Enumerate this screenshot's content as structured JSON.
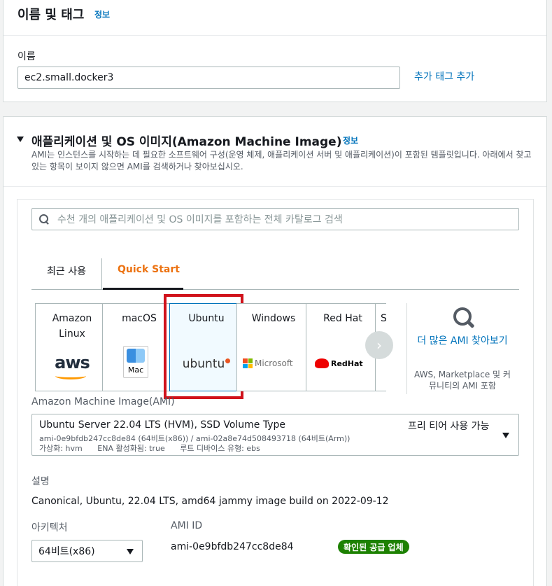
{
  "name_section": {
    "title": "이름 및 태그",
    "info": "정보",
    "name_label": "이름",
    "name_value": "ec2.small.docker3",
    "add_tag": "추가 태그 추가"
  },
  "ami_section": {
    "title": "애플리케이션 및 OS 이미지(Amazon Machine Image)",
    "info": "정보",
    "description": "AMI는 인스턴스를 시작하는 데 필요한 소프트웨어 구성(운영 체제, 애플리케이션 서버 및 애플리케이션)이 포함된 템플릿입니다. 아래에서 찾고 있는 항목이 보이지 않으면 AMI를 검색하거나 찾아보십시오.",
    "search_placeholder": "수천 개의 애플리케이션 및 OS 이미지를 포함하는 전체 카탈로그 검색",
    "tabs": [
      {
        "label": "최근 사용",
        "active": false
      },
      {
        "label": "Quick Start",
        "active": true
      }
    ],
    "os_cards": [
      {
        "name": "Amazon Linux",
        "logo": "aws"
      },
      {
        "name": "macOS",
        "logo": "Mac"
      },
      {
        "name": "Ubuntu",
        "logo": "ubuntu",
        "selected": true
      },
      {
        "name": "Windows",
        "logo": "Microsoft"
      },
      {
        "name": "Red Hat",
        "logo": "RedHat"
      },
      {
        "name": "S"
      }
    ],
    "more": {
      "link": "더 많은 AMI 찾아보기",
      "desc": "AWS, Marketplace 및 커뮤니티의 AMI 포함"
    },
    "ami_label": "Amazon Machine Image(AMI)",
    "ami_selected": {
      "name": "Ubuntu Server 22.04 LTS (HVM), SSD Volume Type",
      "free_tier": "프리 티어 사용 가능",
      "ids": "ami-0e9bfdb247cc8de84 (64비트(x86)) / ami-02a8e74d508493718 (64비트(Arm))",
      "virt": "가상화: hvm",
      "ena": "ENA 활성화됨: true",
      "root": "루트 디바이스 유형: ebs"
    },
    "desc_label": "설명",
    "desc_value": "Canonical, Ubuntu, 22.04 LTS, amd64 jammy image build on 2022-09-12",
    "arch_label": "아키텍처",
    "arch_value": "64비트(x86)",
    "ami_id_label": "AMI ID",
    "ami_id_value": "ami-0e9bfdb247cc8de84",
    "verified_badge": "확인된 공급 업체"
  },
  "colors": {
    "link": "#0073bb",
    "accent": "#ec7211",
    "selected_outline": "#d0121b",
    "badge_green": "#1d8102"
  }
}
